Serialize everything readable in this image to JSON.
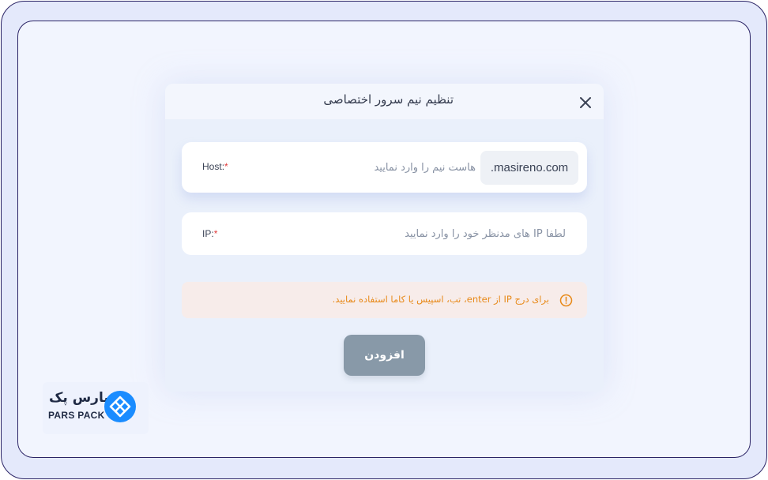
{
  "dialog": {
    "title": "تنظیم نیم سرور اختصاصی",
    "close_icon": "close-icon"
  },
  "host_field": {
    "label": "Host",
    "required_mark": "*",
    "separator": ":",
    "placeholder": "هاست نیم را وارد نمایید",
    "value": "",
    "domain_suffix": ".masireno.com"
  },
  "ip_field": {
    "label": "IP",
    "required_mark": "*",
    "separator": ":",
    "placeholder": "لطفا IP های مدنظر خود را وارد نمایید",
    "value": ""
  },
  "alert": {
    "icon": "info-circle-icon",
    "text": "برای درج IP از enter، تب، اسپیس یا کاما استفاده نمایید."
  },
  "add_button": {
    "label": "افزودن"
  },
  "logo": {
    "text_fa": "پارس پک",
    "text_en": "PARS PACK",
    "icon": "parspack-logo-icon"
  },
  "colors": {
    "accent_logo": "#1a8cff",
    "alert_text": "#e88a1a",
    "alert_bg": "#f7ecea",
    "button_bg": "#8899a8",
    "required": "#e03b3b"
  }
}
